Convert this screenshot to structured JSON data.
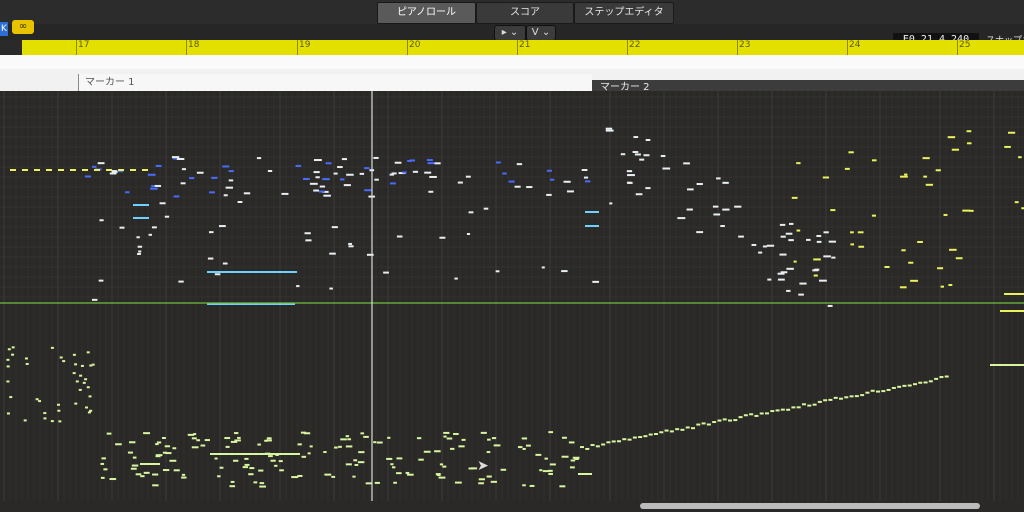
{
  "tabs": [
    {
      "label": "ピアノロール",
      "active": true
    },
    {
      "label": "スコア",
      "active": false
    },
    {
      "label": "ステップエディタ",
      "active": false
    }
  ],
  "toolbar": {
    "pointer_tool_label": "▸ ⌄",
    "v_menu_label": "V ⌄",
    "position_display": "E0   21 4 240",
    "snap_label": "スナップ：",
    "blue_button_label": "K",
    "link_button_label": "∞"
  },
  "ruler": {
    "bars": [
      "17",
      "18",
      "19",
      "20",
      "21",
      "22",
      "23",
      "24",
      "25"
    ],
    "color": "#e3e000"
  },
  "markers": {
    "marker1": "マーカー 1",
    "marker2": "マーカー 2"
  },
  "colors": {
    "note_white": "#e8eef2",
    "note_blue": "#4a6bff",
    "note_cyan": "#6fd1ff",
    "note_yellow": "#eaf25b",
    "note_lightgreen": "#d8f5a0",
    "lane_divider": "#6fbf3f",
    "playhead": "#dddddd"
  }
}
